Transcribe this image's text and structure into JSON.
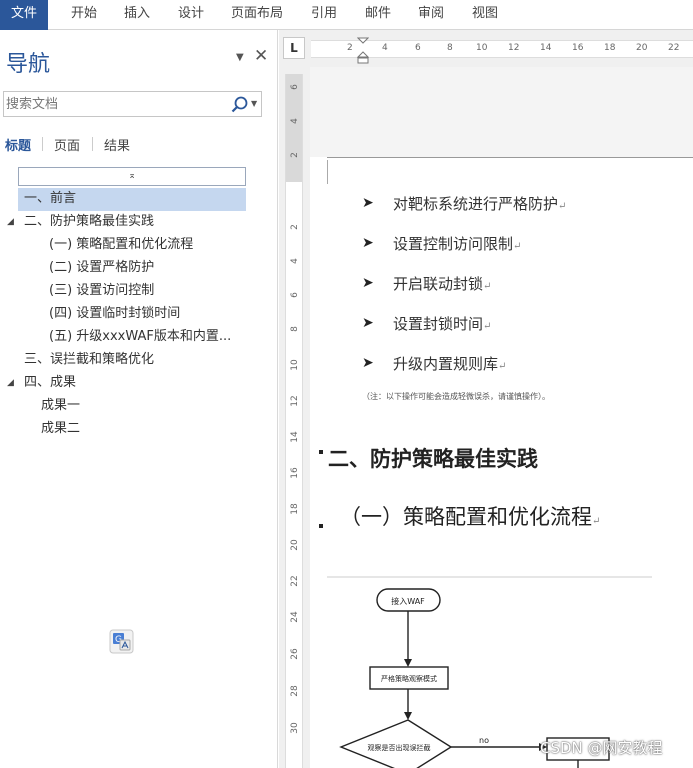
{
  "ribbon": {
    "tabs": [
      "文件",
      "开始",
      "插入",
      "设计",
      "页面布局",
      "引用",
      "邮件",
      "审阅",
      "视图"
    ]
  },
  "nav": {
    "title": "导航",
    "search_placeholder": "搜索文档",
    "subtabs": [
      "标题",
      "页面",
      "结果"
    ],
    "active_subtab": "标题",
    "collapse_glyph": "⌅",
    "tree": [
      {
        "label": "一、前言",
        "level": 1,
        "selected": true,
        "arrow": ""
      },
      {
        "label": "二、防护策略最佳实践",
        "level": 1,
        "arrow": "◢"
      },
      {
        "label": "(一) 策略配置和优化流程",
        "level": 2
      },
      {
        "label": "(二) 设置严格防护",
        "level": 2
      },
      {
        "label": "(三) 设置访问控制",
        "level": 2
      },
      {
        "label": "(四) 设置临时封锁时间",
        "level": 2
      },
      {
        "label": "(五) 升级xxxWAF版本和内置...",
        "level": 2
      },
      {
        "label": "三、误拦截和策略优化",
        "level": 1,
        "arrow": ""
      },
      {
        "label": "四、成果",
        "level": 1,
        "arrow": "◢"
      },
      {
        "label": "成果一",
        "level": 3
      },
      {
        "label": "成果二",
        "level": 3
      }
    ]
  },
  "ruler": {
    "corner": "L",
    "h_ticks": [
      "2",
      "4",
      "6",
      "8",
      "10",
      "12",
      "14",
      "16",
      "18",
      "20",
      "22"
    ],
    "v_ticks": [
      "6",
      "4",
      "2",
      "2",
      "4",
      "6",
      "8",
      "10",
      "12",
      "14",
      "16",
      "18",
      "20",
      "22",
      "24",
      "26",
      "28",
      "30"
    ]
  },
  "document": {
    "bullet_glyph": "➤",
    "bullets": [
      "对靶标系统进行严格防护",
      "设置控制访问限制",
      "开启联动封锁",
      "设置封锁时间",
      "升级内置规则库"
    ],
    "para_mark": "↵",
    "note": "（注：以下操作可能会造成轻微误杀，请谨慎操作）。",
    "heading1": "二、防护策略最佳实践",
    "heading2": "（一）策略配置和优化流程",
    "flow": {
      "start": "接入WAF",
      "step1": "严格策略观察模式",
      "decision": "观察是否出现误拦截",
      "no_label": "no"
    }
  },
  "watermark": "CSDN @网安教程"
}
